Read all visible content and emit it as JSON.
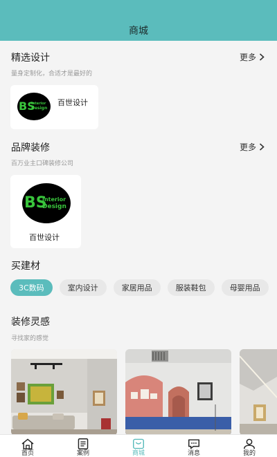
{
  "header": {
    "title": "商城"
  },
  "featured": {
    "title": "精选设计",
    "subtitle": "量身定制化，合适才是最好的",
    "more_label": "更多",
    "items": [
      {
        "label": "百世设计"
      }
    ]
  },
  "brands": {
    "title": "品牌装修",
    "subtitle": "百万业主口碑装修公司",
    "more_label": "更多",
    "items": [
      {
        "label": "百世设计"
      }
    ]
  },
  "materials": {
    "title": "买建材",
    "categories": [
      {
        "label": "3C数码",
        "active": true
      },
      {
        "label": "室内设计",
        "active": false
      },
      {
        "label": "家居用品",
        "active": false
      },
      {
        "label": "服装鞋包",
        "active": false
      },
      {
        "label": "母婴用品",
        "active": false
      }
    ]
  },
  "inspiration": {
    "title": "装修灵感",
    "subtitle": "寻找家的感觉"
  },
  "logo": {
    "initials": "BS",
    "line1": "Interior",
    "line2": "Design"
  },
  "tabbar": {
    "tabs": [
      {
        "label": "首页",
        "icon": "home-icon"
      },
      {
        "label": "案例",
        "icon": "document-icon"
      },
      {
        "label": "商城",
        "icon": "shopping-bag-icon",
        "active": true
      },
      {
        "label": "消息",
        "icon": "message-icon"
      },
      {
        "label": "我的",
        "icon": "user-icon"
      }
    ]
  },
  "colors": {
    "accent": "#5bbcbc",
    "logo_green": "#39c53c"
  }
}
